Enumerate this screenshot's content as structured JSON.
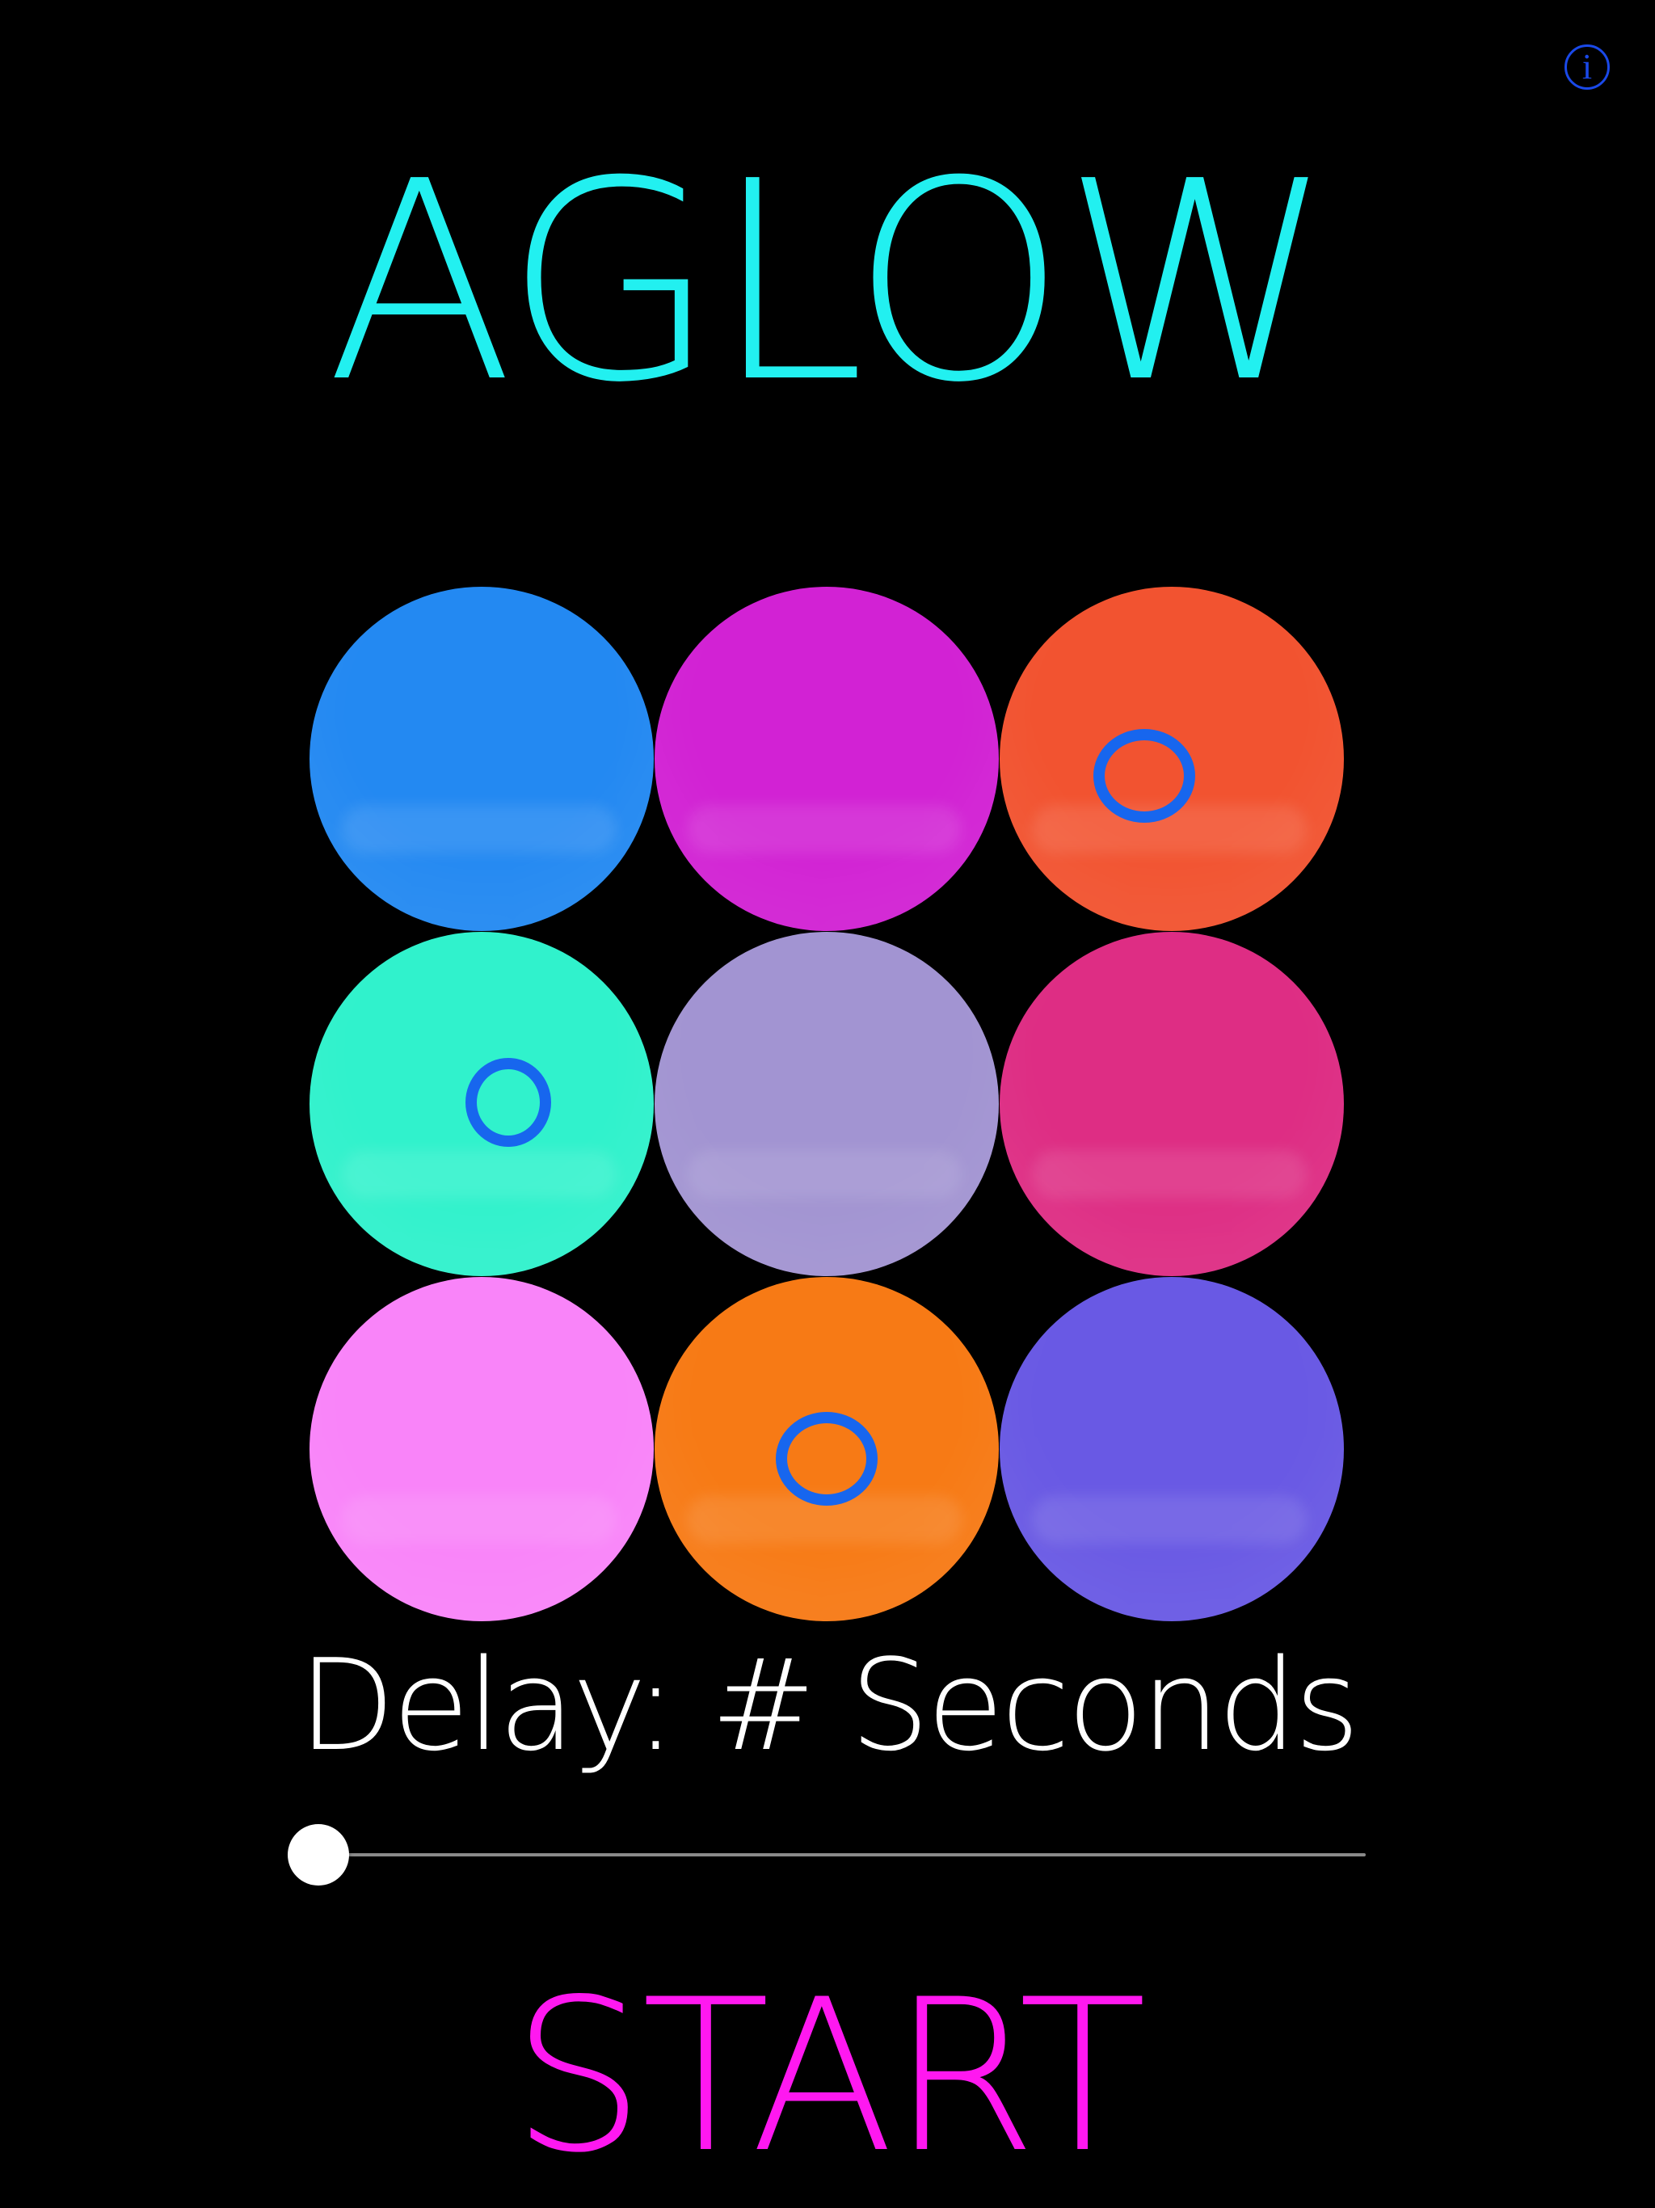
{
  "info_button": {
    "icon": "info-icon",
    "glyph": "i",
    "color": "#1a49e8"
  },
  "title": {
    "text": "AGLOW",
    "color": "#22f0f0"
  },
  "grid": {
    "circles": [
      {
        "name": "blue",
        "color": "#2389f2",
        "marked": false
      },
      {
        "name": "magenta",
        "color": "#d222d4",
        "marked": false
      },
      {
        "name": "red-orange",
        "color": "#f25330",
        "marked": true
      },
      {
        "name": "aqua",
        "color": "#30f2cc",
        "marked": true
      },
      {
        "name": "lavender",
        "color": "#a294d2",
        "marked": false
      },
      {
        "name": "pink",
        "color": "#de2d84",
        "marked": false
      },
      {
        "name": "light-pink",
        "color": "#f984f9",
        "marked": false
      },
      {
        "name": "orange",
        "color": "#f77a15",
        "marked": true
      },
      {
        "name": "purple",
        "color": "#6959e4",
        "marked": false
      }
    ],
    "marker_color": "#1766ee"
  },
  "delay": {
    "label": "Delay: # Seconds"
  },
  "slider": {
    "value": 0
  },
  "start": {
    "label": "START",
    "color": "#ff18f0"
  }
}
